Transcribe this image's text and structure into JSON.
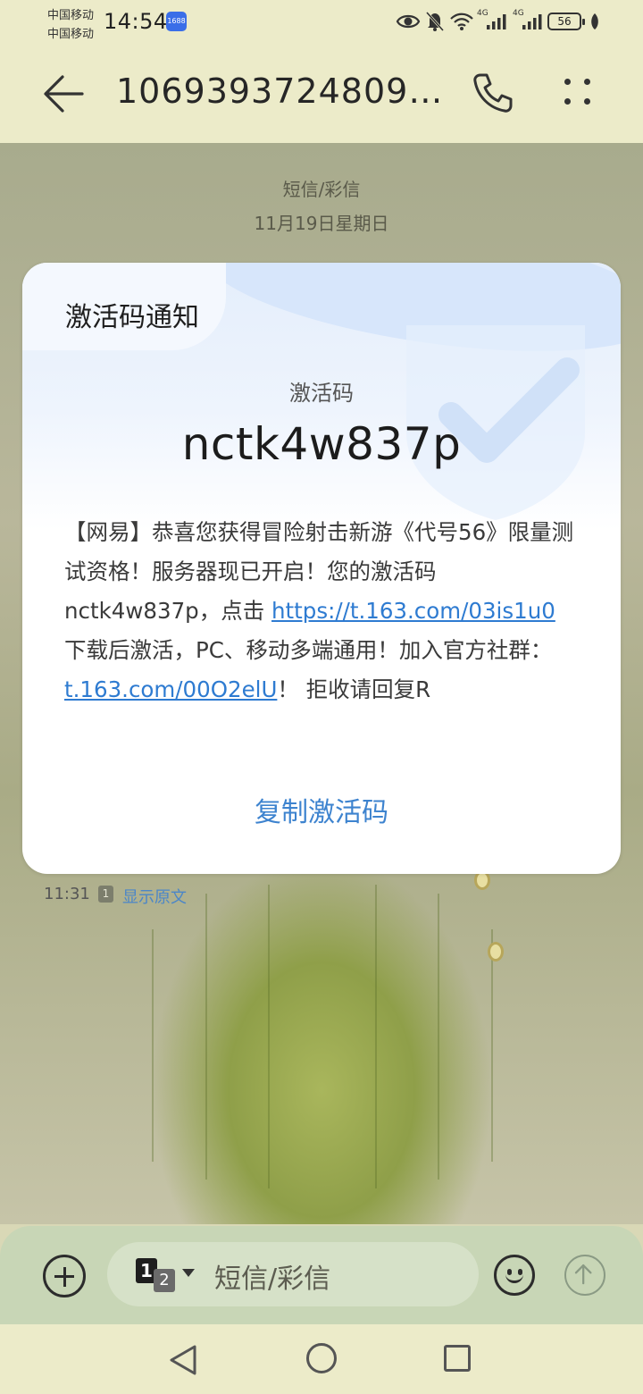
{
  "status_bar": {
    "carrier_1": "中国移动",
    "carrier_2": "中国移动",
    "time": "14:54",
    "app_badge": "1688",
    "network_1": "4G",
    "network_2": "4G",
    "battery": "56"
  },
  "header": {
    "title": "10693937248098..."
  },
  "conversation": {
    "type": "短信/彩信",
    "date": "11月19日星期日"
  },
  "card": {
    "title": "激活码通知",
    "code_label": "激活码",
    "code_value": "nctk4w837p",
    "body_part1": "【网易】恭喜您获得冒险射击新游《代号56》限量测试资格！服务器现已开启！您的激活码 nctk4w837p，点击 ",
    "link_1": "https://t.163.com/03is1u0",
    "body_part2": " 下载后激活，PC、移动多端通用！加入官方社群：",
    "link_2": "t.163.com/00O2elU",
    "body_part3": "！ 拒收请回复R",
    "copy_button": "复制激活码"
  },
  "message_meta": {
    "time": "11:31",
    "sim": "1",
    "show_original": "显示原文"
  },
  "compose": {
    "sim_1": "1",
    "sim_2": "2",
    "placeholder": "短信/彩信"
  },
  "colors": {
    "link": "#2e7bd1",
    "accent": "#3d83cf",
    "header_bg": "#ecebc9",
    "compose_bg": "#c8d6b6"
  },
  "icons": [
    "back-arrow-icon",
    "phone-icon",
    "more-icon",
    "shield-check-icon",
    "add-icon",
    "emoji-icon",
    "send-icon",
    "nav-back-icon",
    "nav-home-icon",
    "nav-recents-icon"
  ]
}
